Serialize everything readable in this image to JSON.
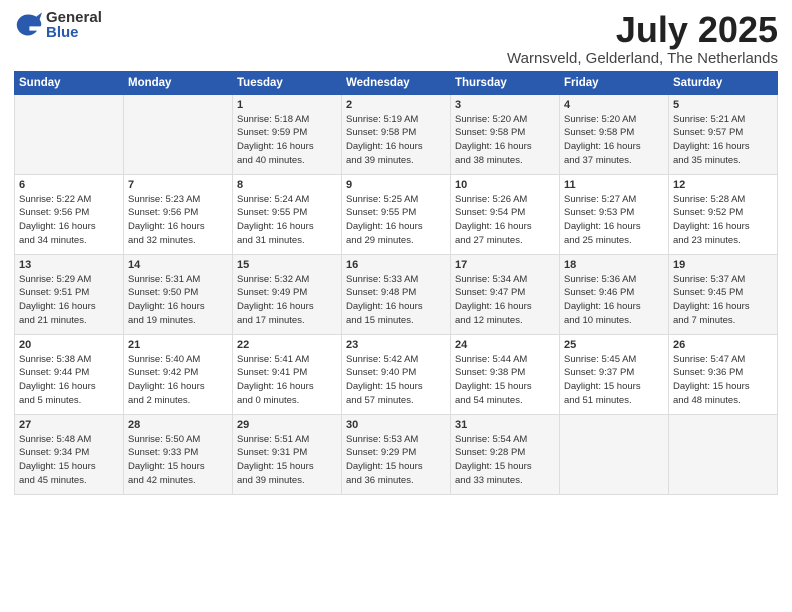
{
  "logo": {
    "general": "General",
    "blue": "Blue"
  },
  "title": "July 2025",
  "subtitle": "Warnsveld, Gelderland, The Netherlands",
  "days_of_week": [
    "Sunday",
    "Monday",
    "Tuesday",
    "Wednesday",
    "Thursday",
    "Friday",
    "Saturday"
  ],
  "weeks": [
    [
      {
        "day": "",
        "info": ""
      },
      {
        "day": "",
        "info": ""
      },
      {
        "day": "1",
        "info": "Sunrise: 5:18 AM\nSunset: 9:59 PM\nDaylight: 16 hours\nand 40 minutes."
      },
      {
        "day": "2",
        "info": "Sunrise: 5:19 AM\nSunset: 9:58 PM\nDaylight: 16 hours\nand 39 minutes."
      },
      {
        "day": "3",
        "info": "Sunrise: 5:20 AM\nSunset: 9:58 PM\nDaylight: 16 hours\nand 38 minutes."
      },
      {
        "day": "4",
        "info": "Sunrise: 5:20 AM\nSunset: 9:58 PM\nDaylight: 16 hours\nand 37 minutes."
      },
      {
        "day": "5",
        "info": "Sunrise: 5:21 AM\nSunset: 9:57 PM\nDaylight: 16 hours\nand 35 minutes."
      }
    ],
    [
      {
        "day": "6",
        "info": "Sunrise: 5:22 AM\nSunset: 9:56 PM\nDaylight: 16 hours\nand 34 minutes."
      },
      {
        "day": "7",
        "info": "Sunrise: 5:23 AM\nSunset: 9:56 PM\nDaylight: 16 hours\nand 32 minutes."
      },
      {
        "day": "8",
        "info": "Sunrise: 5:24 AM\nSunset: 9:55 PM\nDaylight: 16 hours\nand 31 minutes."
      },
      {
        "day": "9",
        "info": "Sunrise: 5:25 AM\nSunset: 9:55 PM\nDaylight: 16 hours\nand 29 minutes."
      },
      {
        "day": "10",
        "info": "Sunrise: 5:26 AM\nSunset: 9:54 PM\nDaylight: 16 hours\nand 27 minutes."
      },
      {
        "day": "11",
        "info": "Sunrise: 5:27 AM\nSunset: 9:53 PM\nDaylight: 16 hours\nand 25 minutes."
      },
      {
        "day": "12",
        "info": "Sunrise: 5:28 AM\nSunset: 9:52 PM\nDaylight: 16 hours\nand 23 minutes."
      }
    ],
    [
      {
        "day": "13",
        "info": "Sunrise: 5:29 AM\nSunset: 9:51 PM\nDaylight: 16 hours\nand 21 minutes."
      },
      {
        "day": "14",
        "info": "Sunrise: 5:31 AM\nSunset: 9:50 PM\nDaylight: 16 hours\nand 19 minutes."
      },
      {
        "day": "15",
        "info": "Sunrise: 5:32 AM\nSunset: 9:49 PM\nDaylight: 16 hours\nand 17 minutes."
      },
      {
        "day": "16",
        "info": "Sunrise: 5:33 AM\nSunset: 9:48 PM\nDaylight: 16 hours\nand 15 minutes."
      },
      {
        "day": "17",
        "info": "Sunrise: 5:34 AM\nSunset: 9:47 PM\nDaylight: 16 hours\nand 12 minutes."
      },
      {
        "day": "18",
        "info": "Sunrise: 5:36 AM\nSunset: 9:46 PM\nDaylight: 16 hours\nand 10 minutes."
      },
      {
        "day": "19",
        "info": "Sunrise: 5:37 AM\nSunset: 9:45 PM\nDaylight: 16 hours\nand 7 minutes."
      }
    ],
    [
      {
        "day": "20",
        "info": "Sunrise: 5:38 AM\nSunset: 9:44 PM\nDaylight: 16 hours\nand 5 minutes."
      },
      {
        "day": "21",
        "info": "Sunrise: 5:40 AM\nSunset: 9:42 PM\nDaylight: 16 hours\nand 2 minutes."
      },
      {
        "day": "22",
        "info": "Sunrise: 5:41 AM\nSunset: 9:41 PM\nDaylight: 16 hours\nand 0 minutes."
      },
      {
        "day": "23",
        "info": "Sunrise: 5:42 AM\nSunset: 9:40 PM\nDaylight: 15 hours\nand 57 minutes."
      },
      {
        "day": "24",
        "info": "Sunrise: 5:44 AM\nSunset: 9:38 PM\nDaylight: 15 hours\nand 54 minutes."
      },
      {
        "day": "25",
        "info": "Sunrise: 5:45 AM\nSunset: 9:37 PM\nDaylight: 15 hours\nand 51 minutes."
      },
      {
        "day": "26",
        "info": "Sunrise: 5:47 AM\nSunset: 9:36 PM\nDaylight: 15 hours\nand 48 minutes."
      }
    ],
    [
      {
        "day": "27",
        "info": "Sunrise: 5:48 AM\nSunset: 9:34 PM\nDaylight: 15 hours\nand 45 minutes."
      },
      {
        "day": "28",
        "info": "Sunrise: 5:50 AM\nSunset: 9:33 PM\nDaylight: 15 hours\nand 42 minutes."
      },
      {
        "day": "29",
        "info": "Sunrise: 5:51 AM\nSunset: 9:31 PM\nDaylight: 15 hours\nand 39 minutes."
      },
      {
        "day": "30",
        "info": "Sunrise: 5:53 AM\nSunset: 9:29 PM\nDaylight: 15 hours\nand 36 minutes."
      },
      {
        "day": "31",
        "info": "Sunrise: 5:54 AM\nSunset: 9:28 PM\nDaylight: 15 hours\nand 33 minutes."
      },
      {
        "day": "",
        "info": ""
      },
      {
        "day": "",
        "info": ""
      }
    ]
  ]
}
